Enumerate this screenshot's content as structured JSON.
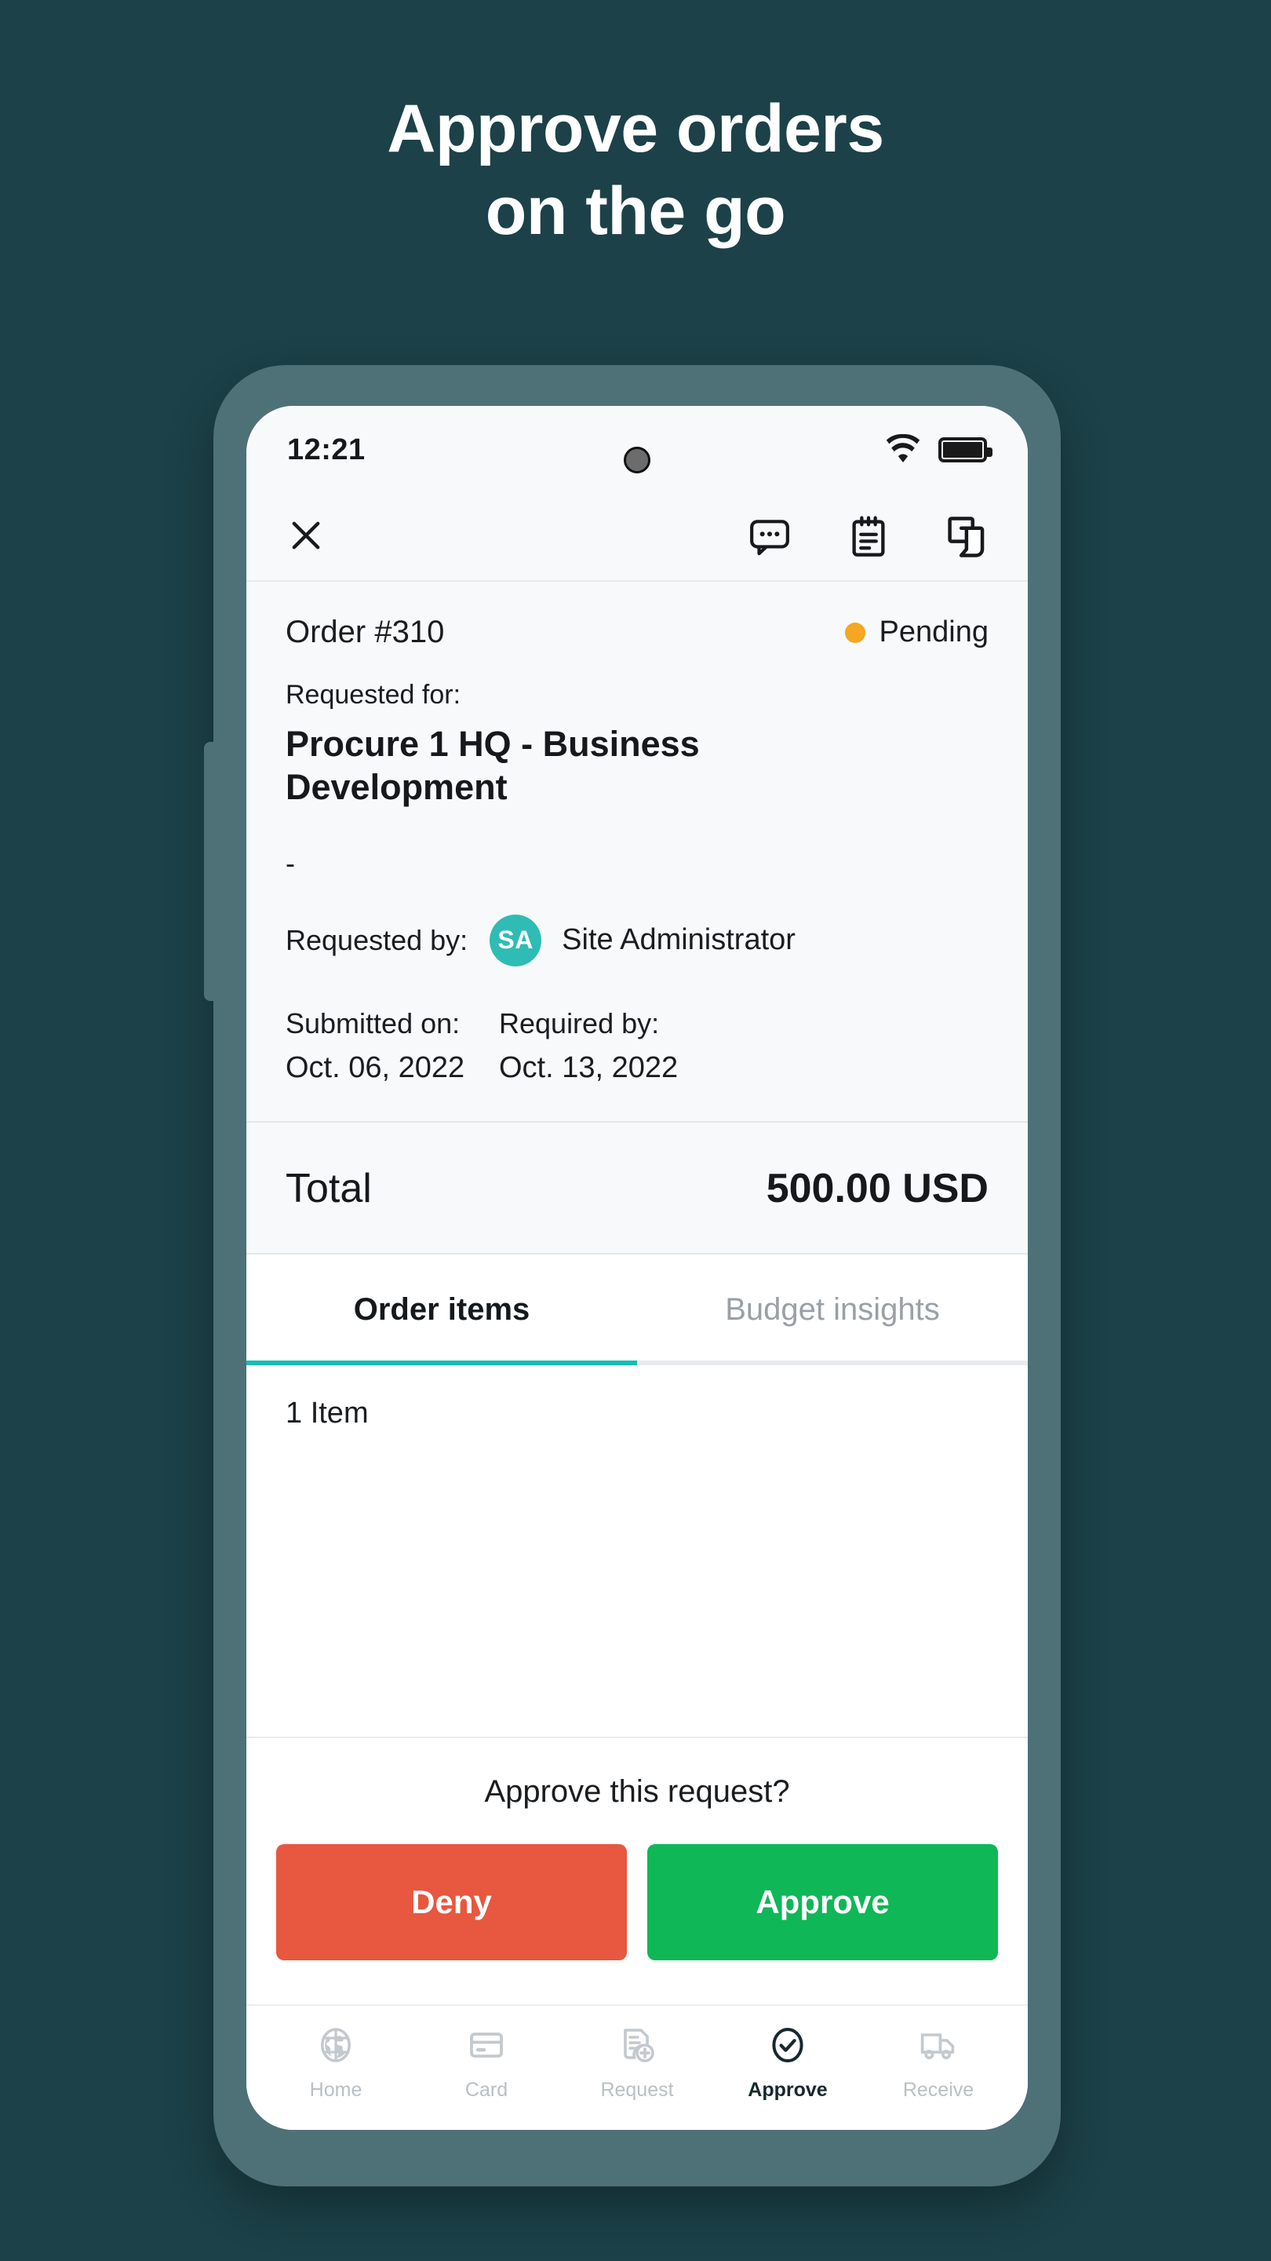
{
  "headline": {
    "line1": "Approve orders",
    "line2": "on the go"
  },
  "colors": {
    "background": "#1c4148",
    "phone_frame": "#4e7077",
    "accent_teal": "#17bdb4",
    "avatar_teal": "#2ebcb4",
    "status_pending": "#f5a623",
    "deny_red": "#e8573f",
    "approve_green": "#0fb757"
  },
  "status_bar": {
    "time": "12:21",
    "wifi_icon": "wifi-icon",
    "battery_icon": "battery-full-icon",
    "camera_icon": "camera-punch-hole"
  },
  "toolbar": {
    "close_icon": "close-icon",
    "comment_icon": "comment-bubble-icon",
    "notes_icon": "notepad-icon",
    "copy_icon": "copy-document-icon"
  },
  "order": {
    "id_label": "Order #310",
    "status_label": "Pending",
    "requested_for_label": "Requested for:",
    "department": "Procure 1 HQ - Business Development",
    "separator": "-",
    "requested_by_label": "Requested by:",
    "requester_initials": "SA",
    "requester_name": "Site Administrator",
    "submitted_on_label": "Submitted on:",
    "submitted_on_value": "Oct. 06, 2022",
    "required_by_label": "Required by:",
    "required_by_value": "Oct. 13, 2022"
  },
  "total": {
    "label": "Total",
    "value": "500.00 USD"
  },
  "tabs": [
    {
      "label": "Order items",
      "active": true
    },
    {
      "label": "Budget insights",
      "active": false
    }
  ],
  "items": {
    "count_label": "1 Item"
  },
  "approve_panel": {
    "question": "Approve this request?",
    "deny_label": "Deny",
    "approve_label": "Approve"
  },
  "bottom_nav": [
    {
      "label": "Home",
      "icon": "globe-icon",
      "active": false
    },
    {
      "label": "Card",
      "icon": "credit-card-icon",
      "active": false
    },
    {
      "label": "Request",
      "icon": "document-plus-icon",
      "active": false
    },
    {
      "label": "Approve",
      "icon": "check-circle-icon",
      "active": true
    },
    {
      "label": "Receive",
      "icon": "truck-icon",
      "active": false
    }
  ]
}
